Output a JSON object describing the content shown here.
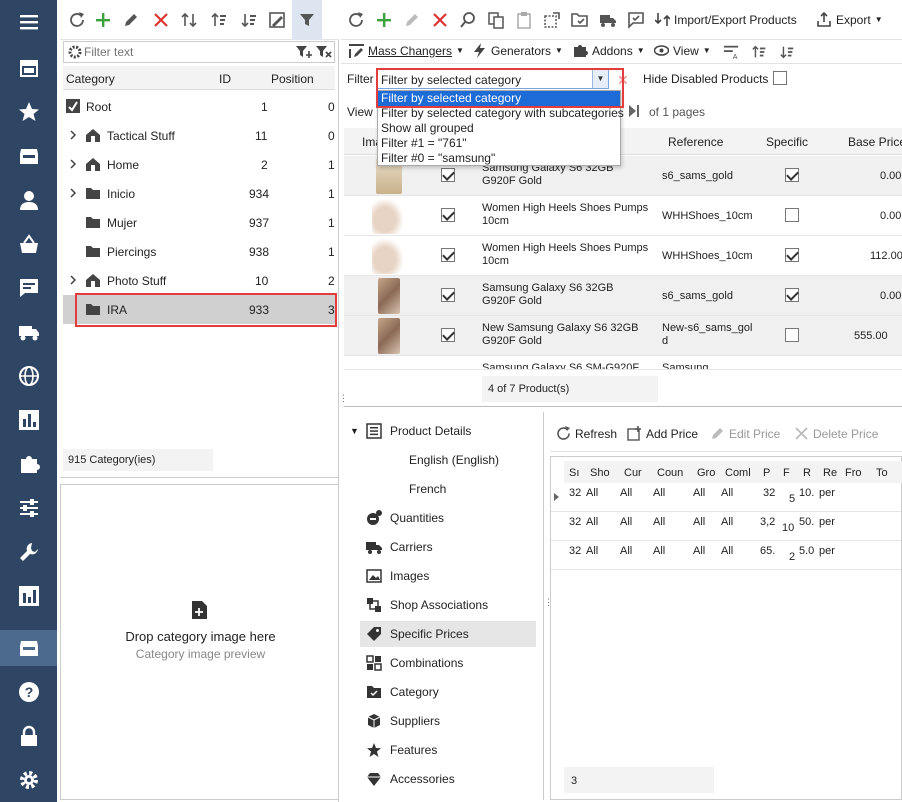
{
  "nav": {
    "items": [
      "menu",
      "store",
      "favorites",
      "orders",
      "customers",
      "baskets",
      "messages",
      "shipping",
      "globe",
      "reports",
      "addons",
      "settings",
      "tools",
      "stats",
      "catalog",
      "help",
      "lock",
      "gear"
    ]
  },
  "category_toolbar": {
    "filter_placeholder": "Filter text"
  },
  "category_table": {
    "headers": {
      "category": "Category",
      "id": "ID",
      "position": "Position"
    },
    "rows": [
      {
        "name": "Root",
        "id": "1",
        "position": "0"
      },
      {
        "name": "Tactical Stuff",
        "id": "11",
        "position": "0"
      },
      {
        "name": "Home",
        "id": "2",
        "position": "1"
      },
      {
        "name": "Inicio",
        "id": "934",
        "position": "1"
      },
      {
        "name": "Mujer",
        "id": "937",
        "position": "1"
      },
      {
        "name": "Piercings",
        "id": "938",
        "position": "1"
      },
      {
        "name": "Photo Stuff",
        "id": "10",
        "position": "2"
      },
      {
        "name": "IRA",
        "id": "933",
        "position": "3"
      }
    ],
    "footer": "915 Category(ies)"
  },
  "image_drop": {
    "title": "Drop category image here",
    "subtitle": "Category image preview"
  },
  "product_toolbar": {
    "import_export": "Import/Export Products",
    "export": "Export",
    "mass_changers": "Mass Changers",
    "generators": "Generators",
    "addons": "Addons",
    "view": "View"
  },
  "filter_bar": {
    "filter_label": "Filter",
    "filter_value": "Filter by selected category",
    "hide_disabled": "Hide Disabled Products",
    "view_label": "View",
    "pages": "of 1 pages"
  },
  "filter_dropdown": {
    "options": [
      "Filter by selected category",
      "Filter by selected category with subcategories",
      "Show all grouped",
      "Filter #1 = \"761\"",
      "Filter #0 = \"samsung\""
    ]
  },
  "product_grid": {
    "headers": {
      "image": "Ima",
      "reference": "Reference",
      "specific": "Specific",
      "base_price": "Base Price"
    },
    "rows": [
      {
        "name": "Samsung Galaxy S6 32GB G920F Gold",
        "reference": "s6_sams_gold",
        "enabled": true,
        "specific": true,
        "price": "0.00"
      },
      {
        "name": "Women High Heels Shoes Pumps 10cm",
        "reference": "WHHShoes_10cm",
        "enabled": true,
        "specific": false,
        "price": "0.00"
      },
      {
        "name": "Women High Heels Shoes Pumps 10cm",
        "reference": "WHHShoes_10cm",
        "enabled": true,
        "specific": true,
        "price": "112.00"
      },
      {
        "name": "Samsung Galaxy S6 32GB G920F Gold",
        "reference": "s6_sams_gold",
        "enabled": true,
        "specific": true,
        "price": "0.00"
      },
      {
        "name": "New Samsung Galaxy S6 32GB G920F Gold",
        "reference": "New-s6_sams_gold",
        "enabled": true,
        "specific": false,
        "price": "555.00"
      },
      {
        "name": "Samsung Galaxy S6 SM-G920F",
        "reference": "Samsung",
        "enabled": false,
        "specific": false,
        "price": ""
      }
    ],
    "footer": "4 of 7 Product(s)"
  },
  "details_tree": {
    "product_details": "Product Details",
    "languages": [
      "English (English)",
      "French"
    ],
    "items": [
      "Quantities",
      "Carriers",
      "Images",
      "Shop Associations",
      "Specific Prices",
      "Combinations",
      "Category",
      "Suppliers",
      "Features",
      "Accessories"
    ]
  },
  "price_toolbar": {
    "refresh": "Refresh",
    "add": "Add Price",
    "edit": "Edit Price",
    "delete": "Delete Price"
  },
  "price_grid": {
    "headers": [
      "Sı",
      "Sho",
      "Cur",
      "Coun",
      "Gro",
      "Coml",
      "P",
      "F",
      "R",
      "Re",
      "Fro",
      "To"
    ],
    "rows": [
      [
        "32",
        "All",
        "All",
        "All",
        "All",
        "All",
        "32",
        "5",
        "10.",
        "per"
      ],
      [
        "32",
        "All",
        "All",
        "All",
        "All",
        "All",
        "3,2",
        "10",
        "50.",
        "per"
      ],
      [
        "32",
        "All",
        "All",
        "All",
        "All",
        "All",
        "65.",
        "2",
        "5.0",
        "per"
      ]
    ],
    "footer": "3"
  }
}
